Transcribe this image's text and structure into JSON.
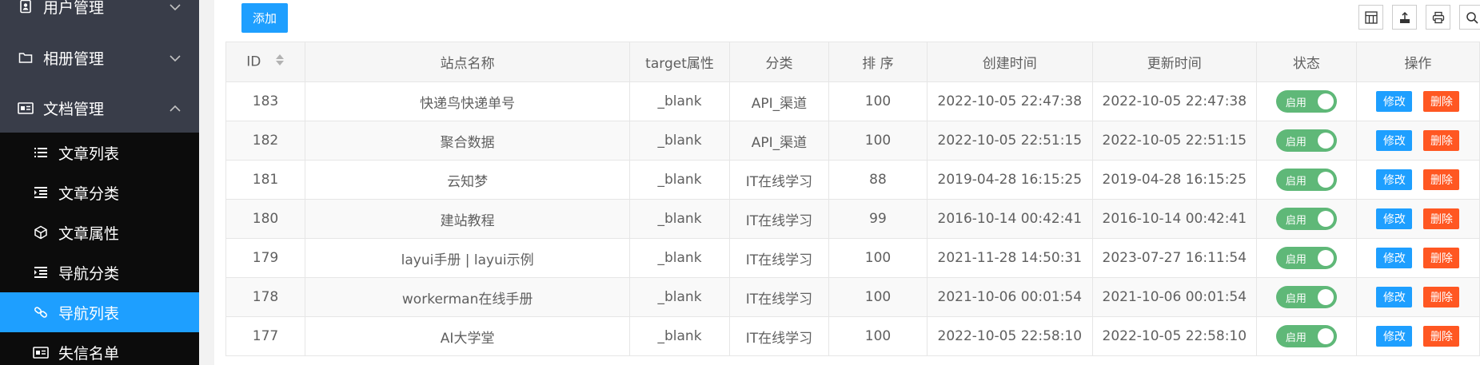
{
  "sidebar": {
    "menus": [
      {
        "label": "用户管理",
        "icon": "contacts-icon",
        "expanded": false
      },
      {
        "label": "相册管理",
        "icon": "folder-icon",
        "expanded": false
      },
      {
        "label": "文档管理",
        "icon": "id-card-icon",
        "expanded": true
      }
    ],
    "subitems": [
      {
        "label": "文章列表",
        "icon": "list-icon"
      },
      {
        "label": "文章分类",
        "icon": "indent-icon"
      },
      {
        "label": "文章属性",
        "icon": "cube-icon"
      },
      {
        "label": "导航分类",
        "icon": "indent-icon"
      },
      {
        "label": "导航列表",
        "icon": "link-icon",
        "active": true
      },
      {
        "label": "失信名单",
        "icon": "id-card-icon"
      }
    ]
  },
  "toolbar": {
    "add_label": "添加",
    "icons": [
      "columns-icon",
      "export-icon",
      "print-icon",
      "search-icon"
    ]
  },
  "table": {
    "headers": [
      "ID",
      "站点名称",
      "target属性",
      "分类",
      "排 序",
      "创建时间",
      "更新时间",
      "状态",
      "操作"
    ],
    "rows": [
      {
        "id": "183",
        "name": "快递鸟快递单号",
        "target": "_blank",
        "category": "API_渠道",
        "sort": "100",
        "created": "2022-10-05 22:47:38",
        "updated": "2022-10-05 22:47:38"
      },
      {
        "id": "182",
        "name": "聚合数据",
        "target": "_blank",
        "category": "API_渠道",
        "sort": "100",
        "created": "2022-10-05 22:51:15",
        "updated": "2022-10-05 22:51:15"
      },
      {
        "id": "181",
        "name": "云知梦",
        "target": "_blank",
        "category": "IT在线学习",
        "sort": "88",
        "created": "2019-04-28 16:15:25",
        "updated": "2019-04-28 16:15:25"
      },
      {
        "id": "180",
        "name": "建站教程",
        "target": "_blank",
        "category": "IT在线学习",
        "sort": "99",
        "created": "2016-10-14 00:42:41",
        "updated": "2016-10-14 00:42:41"
      },
      {
        "id": "179",
        "name": "layui手册 | layui示例",
        "target": "_blank",
        "category": "IT在线学习",
        "sort": "100",
        "created": "2021-11-28 14:50:31",
        "updated": "2023-07-27 16:11:54"
      },
      {
        "id": "178",
        "name": "workerman在线手册",
        "target": "_blank",
        "category": "IT在线学习",
        "sort": "100",
        "created": "2021-10-06 00:01:54",
        "updated": "2021-10-06 00:01:54"
      },
      {
        "id": "177",
        "name": "AI大学堂",
        "target": "_blank",
        "category": "IT在线学习",
        "sort": "100",
        "created": "2022-10-05 22:58:10",
        "updated": "2022-10-05 22:58:10"
      }
    ],
    "status_label": "启用",
    "edit_label": "修改",
    "delete_label": "删除"
  },
  "colors": {
    "sidebar_bg": "#393d49",
    "submenu_bg": "#0c0c0c",
    "accent": "#1e9fff",
    "danger": "#ff5722",
    "switch_on": "#5fb878"
  }
}
